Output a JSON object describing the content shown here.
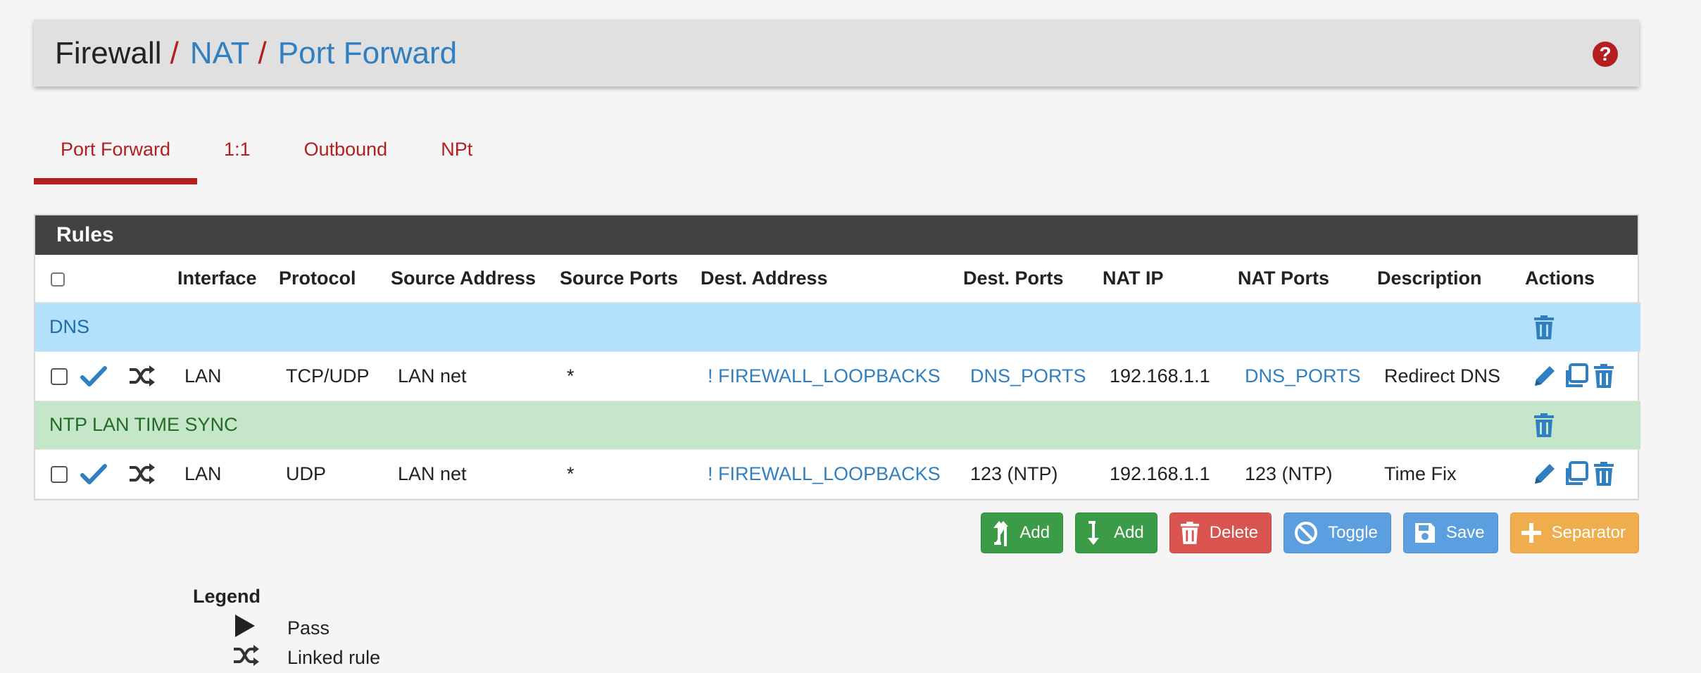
{
  "breadcrumb": {
    "root": "Firewall",
    "sep1": "/",
    "nat": "NAT",
    "sep2": "/",
    "current": "Port Forward",
    "help": "?"
  },
  "tabs": [
    "Port Forward",
    "1:1",
    "Outbound",
    "NPt"
  ],
  "panel": {
    "title": "Rules"
  },
  "columns": [
    "Interface",
    "Protocol",
    "Source Address",
    "Source Ports",
    "Dest. Address",
    "Dest. Ports",
    "NAT IP",
    "NAT Ports",
    "Description",
    "Actions"
  ],
  "separators": {
    "dns": "DNS",
    "ntp": "NTP LAN TIME SYNC"
  },
  "rules": [
    {
      "interface": "LAN",
      "protocol": "TCP/UDP",
      "src_addr": "LAN net",
      "src_ports": "*",
      "dst_addr": "! FIREWALL_LOOPBACKS",
      "dst_ports": "DNS_PORTS",
      "nat_ip": "192.168.1.1",
      "nat_ports": "DNS_PORTS",
      "description": "Redirect DNS"
    },
    {
      "interface": "LAN",
      "protocol": "UDP",
      "src_addr": "LAN net",
      "src_ports": "*",
      "dst_addr": "! FIREWALL_LOOPBACKS",
      "dst_ports": "123 (NTP)",
      "nat_ip": "192.168.1.1",
      "nat_ports": "123 (NTP)",
      "description": "Time Fix"
    }
  ],
  "buttons": {
    "add_top": "Add",
    "add_bottom": "Add",
    "delete": "Delete",
    "toggle": "Toggle",
    "save": "Save",
    "separator": "Separator"
  },
  "legend": {
    "title": "Legend",
    "pass": "Pass",
    "linked": "Linked rule"
  },
  "colors": {
    "accent_red": "#b51e1e",
    "link_blue": "#2f7fc1",
    "dns_separator": "#b3e0fc",
    "ntp_separator": "#c6e6c9",
    "success": "#3c9b46",
    "danger": "#d9534f",
    "info": "#5b9fe0",
    "warning": "#f0ad4e"
  }
}
